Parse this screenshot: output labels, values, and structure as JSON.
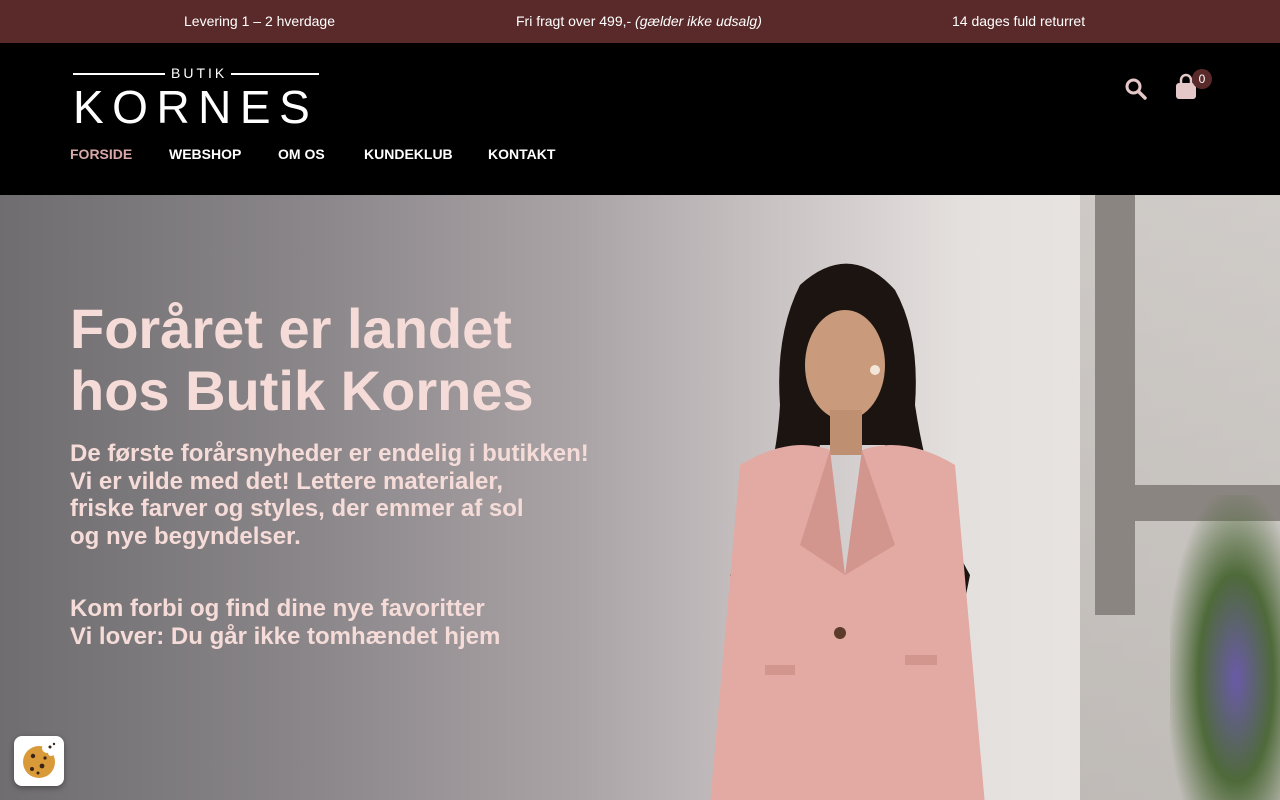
{
  "topbar": {
    "item1": "Levering 1 – 2 hverdage",
    "item2_main": "Fri fragt over 499,- ",
    "item2_note": "(gælder ikke udsalg)",
    "item3": "14 dages fuld returret",
    "background_color": "#5a2a2a"
  },
  "logo": {
    "small": "BUTIK",
    "big": "KORNES"
  },
  "nav": {
    "items": [
      {
        "label": "FORSIDE",
        "active": true
      },
      {
        "label": "WEBSHOP",
        "active": false
      },
      {
        "label": "OM OS",
        "active": false
      },
      {
        "label": "KUNDEKLUB",
        "active": false
      },
      {
        "label": "KONTAKT",
        "active": false
      }
    ],
    "active_color": "#d9a9a9"
  },
  "header_icons": {
    "search_icon": "search-icon",
    "cart_icon": "shopping-bag-icon",
    "cart_count": "0"
  },
  "hero": {
    "title_line1": "Foråret er landet",
    "title_line2": "hos Butik Kornes",
    "body_line1": "De første forårsnyheder er endelig i butikken!",
    "body_line2": "Vi er vilde med det! Lettere materialer,",
    "body_line3": "friske farver og styles, der emmer af sol",
    "body_line4": "og nye begyndelser.",
    "body2_line1": "Kom forbi og find dine nye favoritter",
    "body2_line2": "Vi lover: Du går ikke tomhændet hjem",
    "text_color": "#f6dcd8"
  },
  "cookie": {
    "icon": "cookie-icon"
  }
}
